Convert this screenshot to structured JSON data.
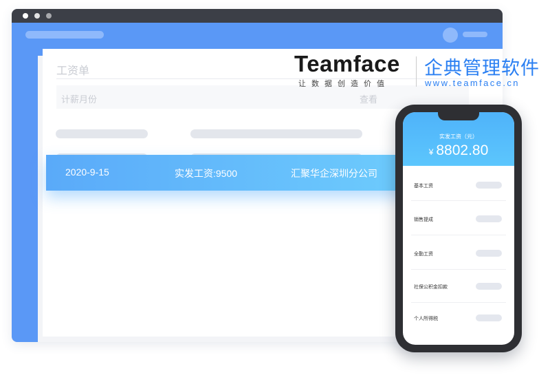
{
  "window": {
    "page_title": "工资单",
    "table_headers": {
      "month": "计薪月份",
      "view": "查看"
    }
  },
  "highlight_row": {
    "date": "2020-9-15",
    "salary": "实发工资:9500",
    "company": "汇聚华企深圳分公司"
  },
  "logo": {
    "brand": "Teamface",
    "slogan": "让数据创造价值",
    "product": "企典管理软件",
    "url": "www.teamface.cn"
  },
  "phone": {
    "header_label": "实发工资（元）",
    "currency_symbol": "¥",
    "amount": "8802.80",
    "items": [
      {
        "label": "基本工资"
      },
      {
        "label": "销售提成"
      },
      {
        "label": "全勤工资"
      },
      {
        "label": "社保公积金扣款"
      },
      {
        "label": "个人所得税"
      }
    ]
  },
  "colors": {
    "accent_blue": "#5a98f6",
    "highlight_start": "#5aaaf9",
    "highlight_end": "#6ecdfd",
    "brand_blue": "#2a7ff2",
    "phone_body": "#2e2f33"
  },
  "icons": [
    "window-dot-icon",
    "avatar-icon"
  ]
}
